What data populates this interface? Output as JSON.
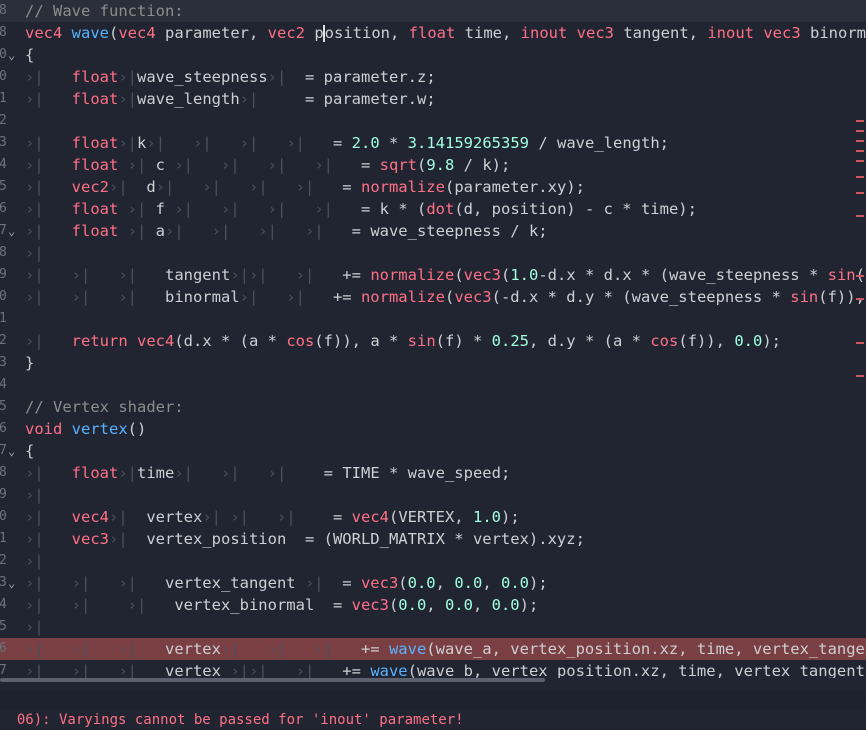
{
  "editor": {
    "lines": [
      {
        "num": "8",
        "fold": "",
        "cls": "current",
        "tokens": [
          [
            "cm",
            "// Wave function:"
          ]
        ]
      },
      {
        "num": "8",
        "fold": "",
        "cls": "",
        "tokens": [
          [
            "ty",
            "vec4"
          ],
          [
            "pl",
            " "
          ],
          [
            "fn",
            "wave"
          ],
          [
            "pl",
            "("
          ],
          [
            "ty",
            "vec4"
          ],
          [
            "pl",
            " parameter, "
          ],
          [
            "ty",
            "vec2"
          ],
          [
            "pl",
            " p"
          ],
          [
            "cursor",
            ""
          ],
          [
            "pl",
            "osition, "
          ],
          [
            "ty",
            "float"
          ],
          [
            "pl",
            " time, "
          ],
          [
            "kw",
            "inout"
          ],
          [
            "pl",
            " "
          ],
          [
            "ty",
            "vec3"
          ],
          [
            "pl",
            " tangent, "
          ],
          [
            "kw",
            "inout"
          ],
          [
            "pl",
            " "
          ],
          [
            "ty",
            "vec3"
          ],
          [
            "pl",
            " binormal"
          ]
        ]
      },
      {
        "num": "0",
        "fold": "v",
        "cls": "",
        "tokens": [
          [
            "pl",
            "{"
          ]
        ]
      },
      {
        "num": "0",
        "fold": "",
        "cls": "",
        "tokens": [
          [
            "tab",
            "›|   "
          ],
          [
            "ty",
            "float"
          ],
          [
            "tab",
            "›|"
          ],
          [
            "pl",
            "wave_steepness"
          ],
          [
            "tab",
            "›|"
          ],
          [
            "pl",
            "  = parameter.z;"
          ]
        ]
      },
      {
        "num": "1",
        "fold": "",
        "cls": "",
        "tokens": [
          [
            "tab",
            "›|   "
          ],
          [
            "ty",
            "float"
          ],
          [
            "tab",
            "›|"
          ],
          [
            "pl",
            "wave_length"
          ],
          [
            "tab",
            "›|"
          ],
          [
            "pl",
            "     = parameter.w;"
          ]
        ]
      },
      {
        "num": "2",
        "fold": "",
        "cls": "",
        "tokens": []
      },
      {
        "num": "3",
        "fold": "",
        "cls": "",
        "tokens": [
          [
            "tab",
            "›|   "
          ],
          [
            "ty",
            "float"
          ],
          [
            "tab",
            "›|"
          ],
          [
            "pl",
            "k"
          ],
          [
            "tab",
            "›|   ›|   ›|   ›|"
          ],
          [
            "pl",
            "   = "
          ],
          [
            "num",
            "2.0"
          ],
          [
            "pl",
            " * "
          ],
          [
            "num",
            "3.14159265359"
          ],
          [
            "pl",
            " / wave_length;"
          ]
        ]
      },
      {
        "num": "4",
        "fold": "",
        "cls": "",
        "tokens": [
          [
            "tab",
            "›|   "
          ],
          [
            "ty",
            "float"
          ],
          [
            "tab",
            " ›| "
          ],
          [
            "pl",
            "c"
          ],
          [
            "tab",
            " ›|   ›|   ›|   ›|"
          ],
          [
            "pl",
            "   = "
          ],
          [
            "bi",
            "sqrt"
          ],
          [
            "pl",
            "("
          ],
          [
            "num",
            "9.8"
          ],
          [
            "pl",
            " / k);"
          ]
        ]
      },
      {
        "num": "5",
        "fold": "",
        "cls": "",
        "tokens": [
          [
            "tab",
            "›|   "
          ],
          [
            "ty",
            "vec2"
          ],
          [
            "tab",
            "›|  "
          ],
          [
            "pl",
            "d"
          ],
          [
            "tab",
            "›|   ›|   ›|   ›|"
          ],
          [
            "pl",
            "   = "
          ],
          [
            "bi",
            "normalize"
          ],
          [
            "pl",
            "(parameter.xy);"
          ]
        ]
      },
      {
        "num": "6",
        "fold": "",
        "cls": "",
        "tokens": [
          [
            "tab",
            "›|   "
          ],
          [
            "ty",
            "float"
          ],
          [
            "tab",
            " ›| "
          ],
          [
            "pl",
            "f"
          ],
          [
            "tab",
            " ›|   ›|   ›|   ›|"
          ],
          [
            "pl",
            "   = k * ("
          ],
          [
            "bi",
            "dot"
          ],
          [
            "pl",
            "(d, position) - c * time);"
          ]
        ]
      },
      {
        "num": "7",
        "fold": "v",
        "cls": "",
        "tokens": [
          [
            "tab",
            "›|   "
          ],
          [
            "ty",
            "float"
          ],
          [
            "tab",
            " ›| "
          ],
          [
            "pl",
            "a"
          ],
          [
            "tab",
            "›|   ›|   ›|   ›|"
          ],
          [
            "pl",
            "   = wave_steepness / k;"
          ]
        ]
      },
      {
        "num": "8",
        "fold": "",
        "cls": "",
        "tokens": [
          [
            "tab",
            "›|"
          ]
        ]
      },
      {
        "num": "9",
        "fold": "",
        "cls": "",
        "tokens": [
          [
            "tab",
            "›|   ›|   ›|   "
          ],
          [
            "pl",
            "tangent"
          ],
          [
            "tab",
            "›|›|   ›|"
          ],
          [
            "pl",
            "   += "
          ],
          [
            "bi",
            "normalize"
          ],
          [
            "pl",
            "("
          ],
          [
            "bi",
            "vec3"
          ],
          [
            "pl",
            "("
          ],
          [
            "num",
            "1.0"
          ],
          [
            "pl",
            "-d.x * d.x * (wave_steepness * "
          ],
          [
            "bi",
            "sin"
          ],
          [
            "pl",
            "(f)), d.x"
          ]
        ]
      },
      {
        "num": "0",
        "fold": "",
        "cls": "",
        "tokens": [
          [
            "tab",
            "›|   ›|   ›|   "
          ],
          [
            "pl",
            "binormal"
          ],
          [
            "tab",
            "›|   ›|"
          ],
          [
            "pl",
            "   += "
          ],
          [
            "bi",
            "normalize"
          ],
          [
            "pl",
            "("
          ],
          [
            "bi",
            "vec3"
          ],
          [
            "pl",
            "(-d.x * d.y * (wave_steepness * "
          ],
          [
            "bi",
            "sin"
          ],
          [
            "pl",
            "(f)), d.y *"
          ]
        ]
      },
      {
        "num": "1",
        "fold": "",
        "cls": "",
        "tokens": []
      },
      {
        "num": "2",
        "fold": "",
        "cls": "",
        "tokens": [
          [
            "tab",
            "›|   "
          ],
          [
            "kw",
            "return"
          ],
          [
            "pl",
            " "
          ],
          [
            "ty",
            "vec4"
          ],
          [
            "pl",
            "(d.x * (a * "
          ],
          [
            "bi",
            "cos"
          ],
          [
            "pl",
            "(f)), a * "
          ],
          [
            "bi",
            "sin"
          ],
          [
            "pl",
            "(f) * "
          ],
          [
            "num",
            "0.25"
          ],
          [
            "pl",
            ", d.y * (a * "
          ],
          [
            "bi",
            "cos"
          ],
          [
            "pl",
            "(f)), "
          ],
          [
            "num",
            "0.0"
          ],
          [
            "pl",
            ");"
          ]
        ]
      },
      {
        "num": "3",
        "fold": "",
        "cls": "",
        "tokens": [
          [
            "pl",
            "}"
          ]
        ]
      },
      {
        "num": "4",
        "fold": "",
        "cls": "",
        "tokens": []
      },
      {
        "num": "5",
        "fold": "",
        "cls": "",
        "tokens": [
          [
            "cm",
            "// Vertex shader:"
          ]
        ]
      },
      {
        "num": "6",
        "fold": "",
        "cls": "",
        "tokens": [
          [
            "ty",
            "void"
          ],
          [
            "pl",
            " "
          ],
          [
            "fn",
            "vertex"
          ],
          [
            "pl",
            "()"
          ]
        ]
      },
      {
        "num": "7",
        "fold": "v",
        "cls": "",
        "tokens": [
          [
            "pl",
            "{"
          ]
        ]
      },
      {
        "num": "8",
        "fold": "",
        "cls": "",
        "tokens": [
          [
            "tab",
            "›|   "
          ],
          [
            "ty",
            "float"
          ],
          [
            "tab",
            "›|"
          ],
          [
            "pl",
            "time"
          ],
          [
            "tab",
            "›|   ›|   ›|"
          ],
          [
            "pl",
            "    = TIME * wave_speed;"
          ]
        ]
      },
      {
        "num": "9",
        "fold": "",
        "cls": "",
        "tokens": [
          [
            "tab",
            "›|"
          ]
        ]
      },
      {
        "num": "0",
        "fold": "",
        "cls": "",
        "tokens": [
          [
            "tab",
            "›|   "
          ],
          [
            "ty",
            "vec4"
          ],
          [
            "tab",
            "›|  "
          ],
          [
            "pl",
            "vertex"
          ],
          [
            "tab",
            "›| ›|   ›|"
          ],
          [
            "pl",
            "    = "
          ],
          [
            "bi",
            "vec4"
          ],
          [
            "pl",
            "(VERTEX, "
          ],
          [
            "num",
            "1.0"
          ],
          [
            "pl",
            ");"
          ]
        ]
      },
      {
        "num": "1",
        "fold": "",
        "cls": "",
        "tokens": [
          [
            "tab",
            "›|   "
          ],
          [
            "ty",
            "vec3"
          ],
          [
            "tab",
            "›|  "
          ],
          [
            "pl",
            "vertex_position  = (WORLD_MATRIX * vertex).xyz;"
          ]
        ]
      },
      {
        "num": "2",
        "fold": "",
        "cls": "",
        "tokens": [
          [
            "tab",
            "›|"
          ]
        ]
      },
      {
        "num": "3",
        "fold": "v",
        "cls": "",
        "tokens": [
          [
            "tab",
            "›|   ›|   ›|   "
          ],
          [
            "pl",
            "vertex_tangent"
          ],
          [
            "tab",
            " ›|"
          ],
          [
            "pl",
            "  = "
          ],
          [
            "bi",
            "vec3"
          ],
          [
            "pl",
            "("
          ],
          [
            "num",
            "0.0"
          ],
          [
            "pl",
            ", "
          ],
          [
            "num",
            "0.0"
          ],
          [
            "pl",
            ", "
          ],
          [
            "num",
            "0.0"
          ],
          [
            "pl",
            ");"
          ]
        ]
      },
      {
        "num": "4",
        "fold": "",
        "cls": "",
        "tokens": [
          [
            "tab",
            "›|   ›|    ›|   "
          ],
          [
            "pl",
            "vertex_binormal  = "
          ],
          [
            "bi",
            "vec3"
          ],
          [
            "pl",
            "("
          ],
          [
            "num",
            "0.0"
          ],
          [
            "pl",
            ", "
          ],
          [
            "num",
            "0.0"
          ],
          [
            "pl",
            ", "
          ],
          [
            "num",
            "0.0"
          ],
          [
            "pl",
            ");"
          ]
        ]
      },
      {
        "num": "5",
        "fold": "",
        "cls": "",
        "tokens": [
          [
            "tab",
            "›|"
          ]
        ]
      },
      {
        "num": "6",
        "fold": "",
        "cls": "error",
        "tokens": [
          [
            "tab",
            "›|   ›|   ›|   "
          ],
          [
            "pl",
            "vertex"
          ],
          [
            "tab",
            "›|   ›|   ›|"
          ],
          [
            "pl",
            "   += "
          ],
          [
            "fn",
            "wave"
          ],
          [
            "pl",
            "(wave_a, vertex_position.xz, time, vertex_tangent, vertex"
          ]
        ]
      },
      {
        "num": "7",
        "fold": "",
        "cls": "",
        "tokens": [
          [
            "tab",
            "›|   ›|   ›|   "
          ],
          [
            "pl",
            "vertex"
          ],
          [
            "tab",
            " ›|›|   ›|"
          ],
          [
            "pl",
            "   += "
          ],
          [
            "fn",
            "wave"
          ],
          [
            "pl",
            "(wave_b, vertex_position.xz, time, vertex_tangent, vertex"
          ]
        ]
      }
    ]
  },
  "status": {
    "error_message": "06): Varyings cannot be passed for 'inout' parameter!"
  },
  "colors": {
    "background": "#202531",
    "keyword": "#ff7085",
    "function": "#57b3ff",
    "number": "#a1ffe0",
    "comment": "#8d8d8d",
    "error_line": "#7a3f42"
  }
}
